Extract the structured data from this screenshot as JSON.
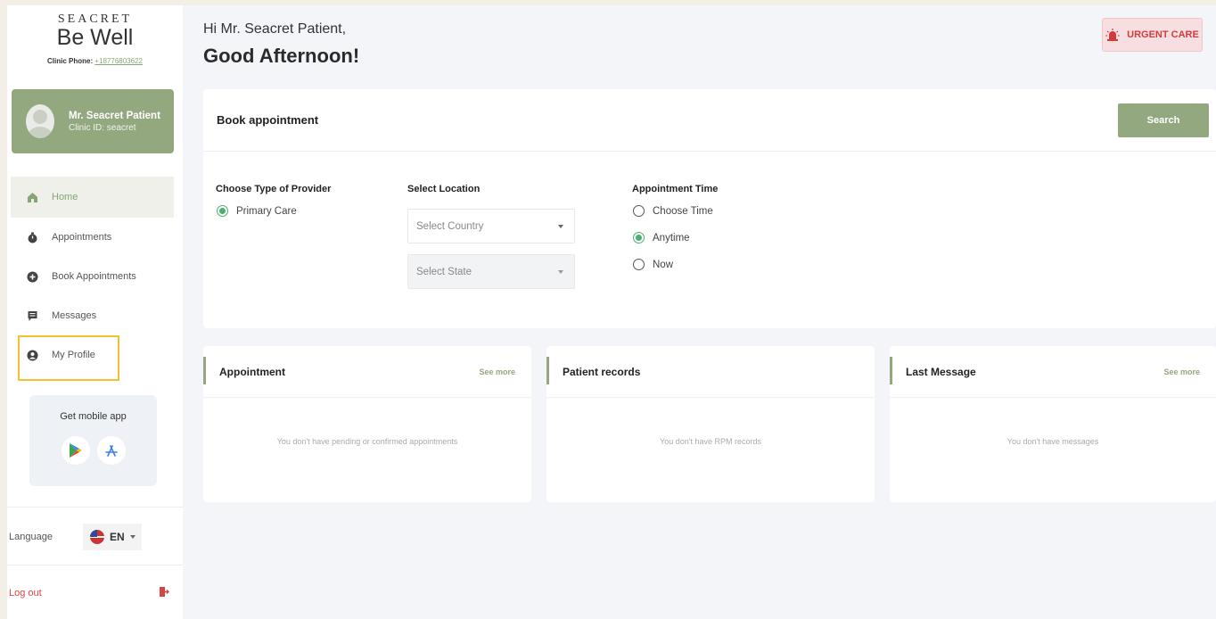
{
  "brand": {
    "top": "SEACRET",
    "main": "Be Well",
    "phone_label": "Clinic Phone:",
    "phone_number": "+18776803622"
  },
  "profile": {
    "name": "Mr. Seacret Patient",
    "clinic_id": "Clinic ID: seacret"
  },
  "nav": {
    "items": [
      {
        "label": "Home",
        "icon": "home-icon"
      },
      {
        "label": "Appointments",
        "icon": "stopwatch-icon"
      },
      {
        "label": "Book Appointments",
        "icon": "plus-circle-icon"
      },
      {
        "label": "Messages",
        "icon": "message-icon"
      },
      {
        "label": "My Profile",
        "icon": "user-circle-icon"
      }
    ],
    "active_index": 0
  },
  "mobile": {
    "title": "Get mobile app"
  },
  "language": {
    "label": "Language",
    "value": "EN"
  },
  "logout": {
    "label": "Log out"
  },
  "header": {
    "greeting": "Hi Mr. Seacret Patient,",
    "salutation": "Good Afternoon!",
    "urgent_label": "URGENT CARE"
  },
  "book": {
    "title": "Book appointment",
    "search_label": "Search",
    "provider_label": "Choose Type of Provider",
    "provider_option": "Primary Care",
    "location_label": "Select Location",
    "country_placeholder": "Select Country",
    "state_placeholder": "Select State",
    "time_label": "Appointment Time",
    "time_options": [
      "Choose Time",
      "Anytime",
      "Now"
    ],
    "time_selected": "Anytime"
  },
  "cards": {
    "appointment": {
      "title": "Appointment",
      "see_more": "See more",
      "empty": "You don't have pending or confirmed appointments"
    },
    "records": {
      "title": "Patient records",
      "empty": "You don't have RPM records"
    },
    "message": {
      "title": "Last Message",
      "see_more": "See more",
      "empty": "You don't have messages"
    }
  },
  "colors": {
    "accent": "#93a87f",
    "urgent": "#d03c3c",
    "background": "#f3f5f9"
  }
}
